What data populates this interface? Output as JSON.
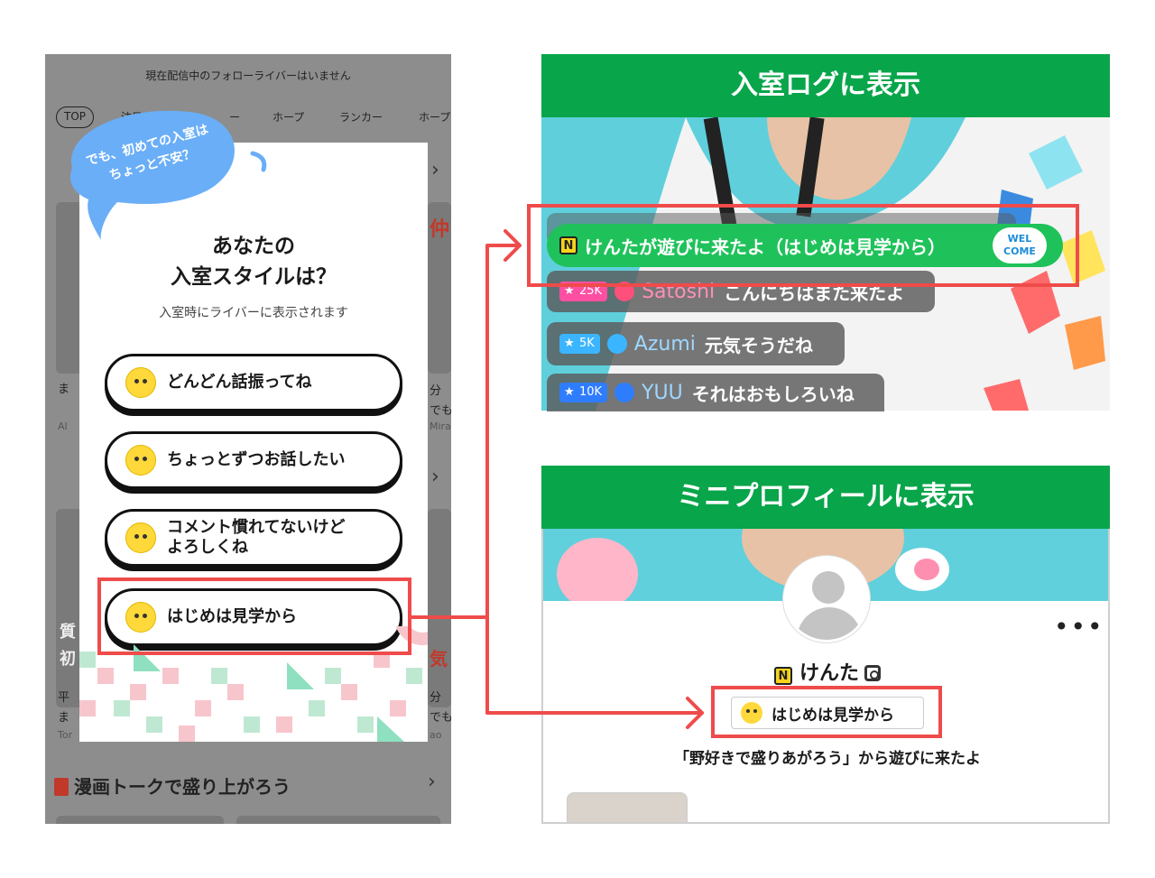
{
  "colors": {
    "accent_green": "#08a54a",
    "highlight_red": "#ef4b4b",
    "bubble_blue": "#6aaef7",
    "welcome_green": "#1fc25a"
  },
  "phone": {
    "notice": "現在配信中のフォローライバーはいません",
    "tabs": [
      "TOP",
      "注目50",
      "ー",
      "ホープ",
      "ランカー",
      "ホープ"
    ],
    "background_snippets": {
      "left_col": [
        "ま",
        "AI",
        "平",
        "ま",
        "Tor"
      ],
      "right_col": [
        "仲",
        "分",
        "でも",
        "Mirai",
        "気",
        "分",
        "でも",
        "ao"
      ],
      "left_mid": [
        "質",
        "初"
      ]
    },
    "bottom_title": "漫画トークで盛り上がろう"
  },
  "modal": {
    "bubble": "でも、初めての入室は\nちょっと不安？",
    "title_line1": "あなたの",
    "title_line2": "入室スタイルは？",
    "subtitle": "入室時にライバーに表示されます",
    "options": [
      {
        "label": "どんどん話振ってね",
        "icon": "winking-face-icon"
      },
      {
        "label": "ちょっとずつお話したい",
        "icon": "smiling-face-icon"
      },
      {
        "label": "コメント慣れてないけど\nよろしくね",
        "icon": "slightly-smiling-face-icon"
      },
      {
        "label": "はじめは見学から",
        "icon": "monocle-face-icon"
      }
    ]
  },
  "panel_log": {
    "header": "入室ログに表示",
    "welcome": {
      "n_badge": "N",
      "text": "けんたが遊びに来たよ（はじめは見学から）",
      "badge": "WEL\nCOME"
    },
    "logs": [
      {
        "rank": "25K",
        "name": "Satoshi",
        "message": "こんにちはまた来たよ",
        "rank_color": "#ff4fa3",
        "badge_color": "#ff4f7b"
      },
      {
        "rank": "5K",
        "name": "Azumi",
        "message": "元気そうだね",
        "rank_color": "#3bb5ff",
        "badge_color": "#3bb5ff"
      },
      {
        "rank": "10K",
        "name": "YUU",
        "message": "それはおもしろいね",
        "rank_color": "#2f7dff",
        "badge_color": "#2f7dff"
      }
    ]
  },
  "panel_profile": {
    "header": "ミニプロフィールに表示",
    "name_badge": "N",
    "name": "けんた",
    "more": "•••",
    "style_chip": "はじめは見学から",
    "from_text": "「野好きで盛りあがろう」から遊びに来たよ"
  }
}
